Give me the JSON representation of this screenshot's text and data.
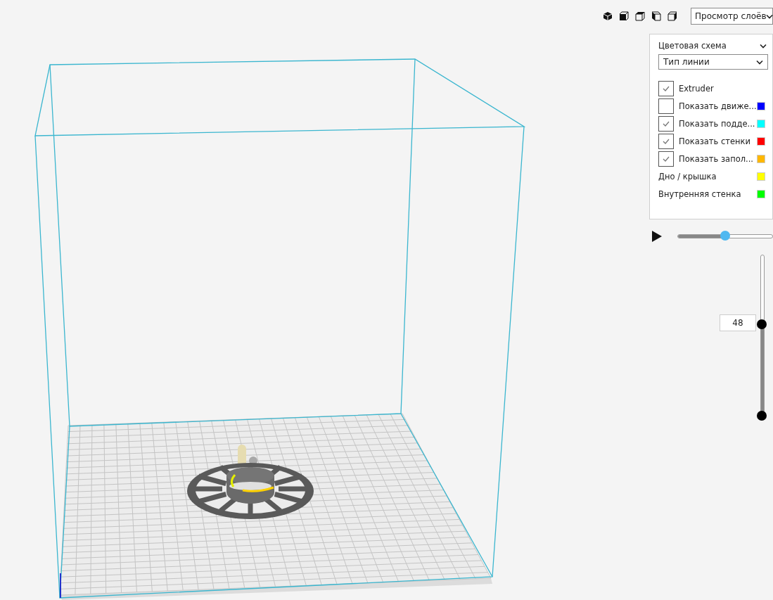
{
  "view_menu": {
    "value": "Просмотр слоёв"
  },
  "color_scheme": {
    "label": "Цветовая схема",
    "value": "Тип линии"
  },
  "legend": {
    "items": [
      {
        "kind": "checkbox",
        "label": "Extruder",
        "checked": true
      },
      {
        "kind": "checkbox",
        "label": "Показать движе...",
        "checked": false,
        "color": "#0000ff"
      },
      {
        "kind": "checkbox",
        "label": "Показать подде...",
        "checked": true,
        "color": "#00ffff"
      },
      {
        "kind": "checkbox",
        "label": "Показать стенки",
        "checked": true,
        "color": "#ff0000"
      },
      {
        "kind": "checkbox",
        "label": "Показать запол...",
        "checked": true,
        "color": "#ffb700"
      },
      {
        "kind": "legend",
        "label": "Дно / крышка",
        "color": "#ffff00"
      },
      {
        "kind": "legend",
        "label": "Внутренняя стенка",
        "color": "#00ff00"
      }
    ]
  },
  "playback": {
    "level": 0.5
  },
  "layer_slider": {
    "level": 0.57,
    "value": "48"
  }
}
